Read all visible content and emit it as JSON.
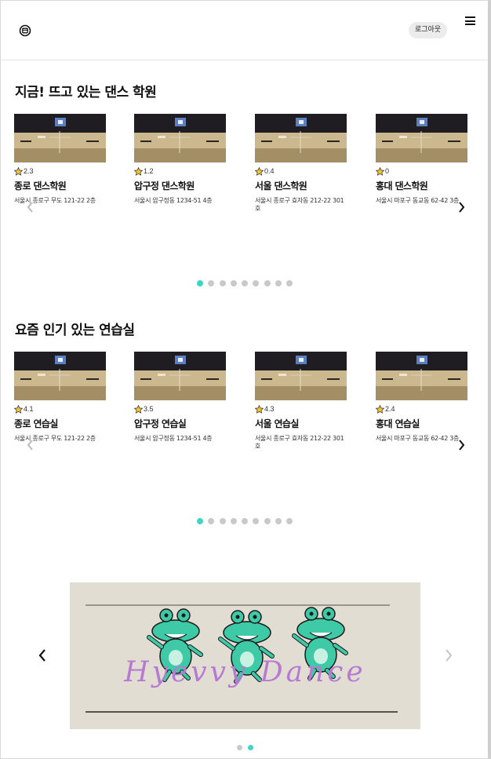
{
  "header": {
    "logo_icon": "logo-circle-icon",
    "logout_label": "로그아웃",
    "menu_icon": "hamburger-menu-icon"
  },
  "section1": {
    "title": "지금! 뜨고 있는 댄스 학원",
    "cards": [
      {
        "rating": "2.3",
        "name": "종로 댄스학원",
        "address": "서울시 종로구 무도 121-22 2층"
      },
      {
        "rating": "1.2",
        "name": "압구정 댄스학원",
        "address": "서울시 압구정동 1234-51 4층"
      },
      {
        "rating": "0.4",
        "name": "서울 댄스학원",
        "address": "서울시 종로구 효자동 212-22 301호"
      },
      {
        "rating": "0",
        "name": "홍대 댄스학원",
        "address": "서울시 마포구 동교동 62-42 3층"
      }
    ],
    "dot_count": 9,
    "active_dot": 0
  },
  "section2": {
    "title": "요즘 인기 있는 연습실",
    "cards": [
      {
        "rating": "4.1",
        "name": "종로 연습실",
        "address": "서울시 종로구 무도 121-22 2층"
      },
      {
        "rating": "3.5",
        "name": "압구정 연습실",
        "address": "서울시 압구정동 1234-51 4층"
      },
      {
        "rating": "4.3",
        "name": "서울 연습실",
        "address": "서울시 종로구 효자동 212-22 301호"
      },
      {
        "rating": "2.4",
        "name": "홍대 연습실",
        "address": "서울시 마포구 동교동 62-42 3층"
      }
    ],
    "dot_count": 9,
    "active_dot": 0
  },
  "banner": {
    "text": "Hyevvy Dance",
    "dot_count": 2,
    "active_dot": 1
  },
  "colors": {
    "accent": "#3dd6c6",
    "dot_inactive": "#c9c9c9",
    "banner_bg": "#e2ddd3",
    "banner_text": "#b77ad1",
    "character": "#3ec9a7"
  }
}
